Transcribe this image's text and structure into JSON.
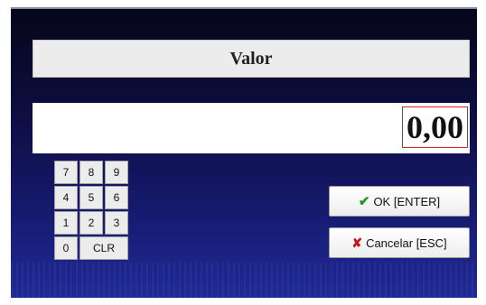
{
  "dialog": {
    "title": "Valor",
    "amount": "0,00"
  },
  "keypad": {
    "keys": [
      "7",
      "8",
      "9",
      "4",
      "5",
      "6",
      "1",
      "2",
      "3",
      "0"
    ],
    "clear_label": "CLR"
  },
  "buttons": {
    "ok_label": "OK [ENTER]",
    "cancel_label": "Cancelar [ESC]"
  },
  "icons": {
    "ok_icon": "check-icon",
    "cancel_icon": "x-icon"
  },
  "colors": {
    "amount_border": "#d62020",
    "ok_icon": "#1e9a1e",
    "cancel_icon": "#c21818"
  }
}
